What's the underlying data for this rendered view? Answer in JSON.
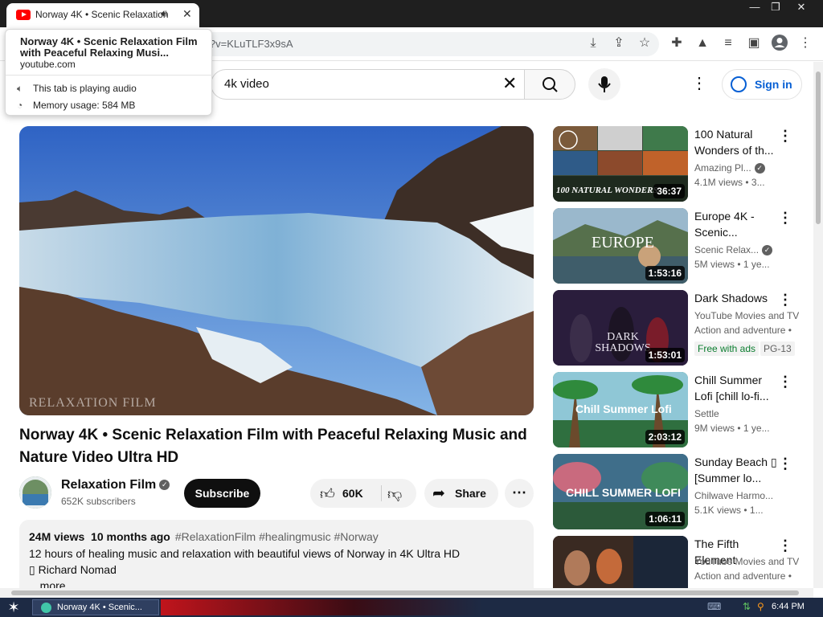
{
  "browser": {
    "tab_title": "Norway 4K • Scenic Relaxation",
    "url": "i?v=KLuTLF3x9sA",
    "window_buttons": [
      "—",
      "❐",
      "✕"
    ]
  },
  "tooltip": {
    "title": "Norway 4K • Scenic Relaxation Film with Peaceful Relaxing Musi...",
    "domain": "youtube.com",
    "audio": "This tab is playing audio",
    "memory": "Memory usage: 584 MB"
  },
  "masthead": {
    "search_query": "4k video",
    "sign_in": "Sign in"
  },
  "video": {
    "watermark": "RELAXATION FILM",
    "title": "Norway 4K • Scenic Relaxation Film with Peaceful Relaxing Music and Nature Video Ultra HD",
    "channel": "Relaxation Film",
    "subscribers": "652K subscribers",
    "subscribe": "Subscribe",
    "likes": "60K",
    "share": "Share"
  },
  "description": {
    "views": "24M views",
    "age": "10 months ago",
    "tags": "#RelaxationFilm #healingmusic #Norway",
    "line1": "12 hours of healing music and relaxation with beautiful views of Norway in 4K Ultra HD",
    "line2": "▯ Richard Nomad",
    "more": "...more"
  },
  "recommendations": [
    {
      "title": "100 Natural Wonders of th...",
      "channel": "Amazing Pl...",
      "verified": true,
      "views": "4.1M views",
      "age": "• 3...",
      "duration": "36:37",
      "thumb_text": "100 NATURAL WONDERS",
      "thumb_bg": "#3a4a3a",
      "badge": null
    },
    {
      "title": "Europe 4K - Scenic...",
      "channel": "Scenic Relax...",
      "verified": true,
      "views": "5M views",
      "age": "• 1 ye...",
      "duration": "1:53:16",
      "thumb_text": "EUROPE",
      "thumb_bg": "#5a6e58",
      "badge": null
    },
    {
      "title": "Dark Shadows",
      "channel": "YouTube Movies and TV",
      "verified": false,
      "views": "Action and adventure •",
      "age": "",
      "duration": "1:53:01",
      "thumb_text": "DARK SHADOWS",
      "thumb_bg": "#2c1f3e",
      "badge": "Free with ads",
      "rating": "PG-13"
    },
    {
      "title": "Chill Summer Lofi [chill lo-fi...",
      "channel": "Settle",
      "verified": false,
      "views": "9M views",
      "age": "• 1 ye...",
      "duration": "2:03:12",
      "thumb_text": "Chill Summer Lofi",
      "thumb_bg": "#3f8a55",
      "badge": null
    },
    {
      "title": "Sunday Beach ▯ [Summer lo...",
      "channel": "Chilwave Harmo...",
      "verified": false,
      "views": "5.1K views",
      "age": "• 1...",
      "duration": "1:06:11",
      "thumb_text": "CHILL SUMMER LOFI",
      "thumb_bg": "#2f5f7c",
      "badge": null
    },
    {
      "title": "The Fifth Element",
      "channel": "YouTube Movies and TV",
      "verified": false,
      "views": "Action and adventure •",
      "age": "",
      "duration": "",
      "thumb_text": "",
      "thumb_bg": "#1e2430",
      "badge": null
    }
  ],
  "taskbar": {
    "app": "Norway 4K • Scenic...",
    "time": "6:44 PM"
  }
}
